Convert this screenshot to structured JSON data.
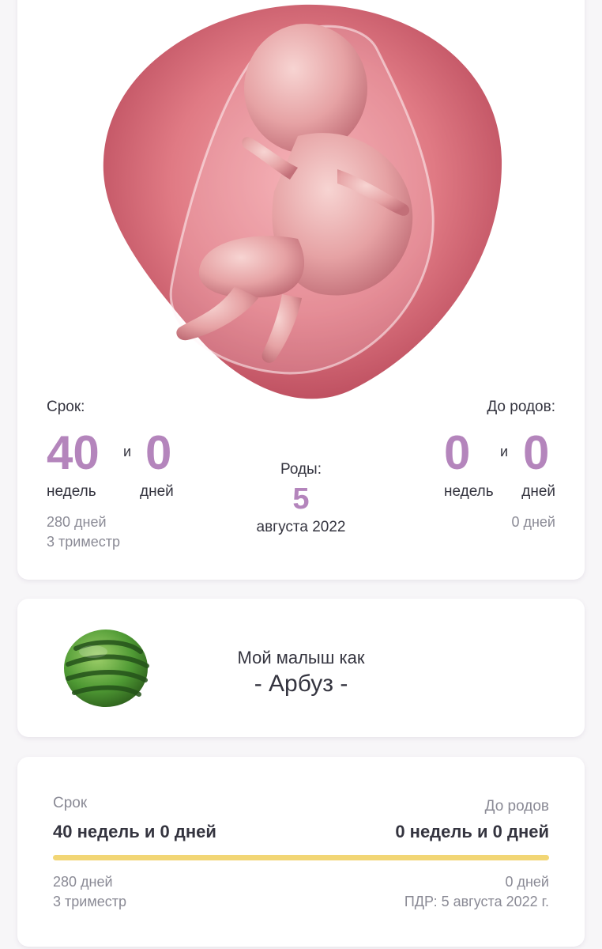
{
  "term_card": {
    "term_label": "Срок:",
    "weeks_value": "40",
    "and_text": "и",
    "days_value": "0",
    "weeks_unit": "недель",
    "days_unit": "дней",
    "total_days": "280 дней",
    "trimester": "3 триместр",
    "birth_label": "Роды:",
    "birth_day": "5",
    "birth_month_year": "августа 2022",
    "remaining_label": "До родов:",
    "remaining_weeks_value": "0",
    "remaining_and_text": "и",
    "remaining_days_value": "0",
    "remaining_weeks_unit": "недель",
    "remaining_days_unit": "дней",
    "remaining_total_days": "0 дней"
  },
  "size_card": {
    "caption": "Мой малыш как",
    "fruit_name": "- Арбуз -",
    "fruit_icon": "watermelon-icon"
  },
  "summary_card": {
    "term_label": "Срок",
    "term_value": "40 недель и 0 дней",
    "remaining_label": "До родов",
    "remaining_value": "0 недель и 0 дней",
    "progress_fraction": 1.0,
    "total_days": "280 дней",
    "trimester": "3 триместр",
    "remaining_days": "0 дней",
    "due_date": "ПДР: 5 августа 2022 г."
  },
  "colors": {
    "accent_purple": "#b485bc",
    "progress_yellow": "#f2d675",
    "womb_pink": "#d96f7a"
  }
}
